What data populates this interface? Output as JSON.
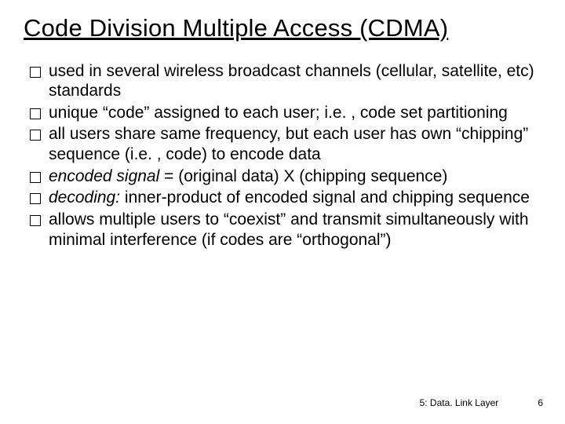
{
  "title": "Code Division Multiple Access (CDMA)",
  "bullets": {
    "b0": "used  in several wireless broadcast channels (cellular, satellite, etc) standards",
    "b1": "unique “code” assigned to each user; i.e. , code set partitioning",
    "b2": "all users share same frequency, but each user has own “chipping” sequence (i.e. , code) to encode data",
    "b3_em": "encoded signal",
    "b3_rest": " = (original data) X (chipping sequence)",
    "b4_em": "decoding:",
    "b4_rest": " inner-product of encoded signal and chipping sequence",
    "b5": "allows multiple users to “coexist” and transmit simultaneously with minimal interference (if codes are “orthogonal”)"
  },
  "footer": {
    "chapter": "5: Data. Link Layer",
    "page": "6"
  }
}
